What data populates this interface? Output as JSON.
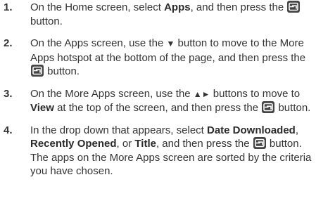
{
  "steps": [
    {
      "number": "1.",
      "t1": "On the Home screen, select ",
      "b1": "Apps",
      "t2": ", and then press the ",
      "t3": " button."
    },
    {
      "number": "2.",
      "t1": "On the Apps screen, use the ",
      "glyph": "▼",
      "t2": " button to move to the More Apps hotspot at the bottom of the page, and then press the ",
      "t3": " button."
    },
    {
      "number": "3.",
      "t1": "On the More Apps screen, use the ",
      "glyph": "▲►",
      "t2": " buttons to move to ",
      "b1": "View",
      "t3": " at the top of the screen, and then press the ",
      "t4": " button."
    },
    {
      "number": "4.",
      "t1": "In the drop down that appears, select ",
      "b1": "Date Downloaded",
      "t2": ", ",
      "b2": "Recently Opened",
      "t3": ", or ",
      "b3": "Title",
      "t4": ", and then press the ",
      "t5": " button. The apps on the More Apps screen are sorted by the criteria you have chosen."
    }
  ],
  "icons": {
    "enter": "enter-button-icon"
  },
  "colors": {
    "text": "#333333",
    "icon_bg": "#444444",
    "icon_fg": "#ffffff"
  }
}
